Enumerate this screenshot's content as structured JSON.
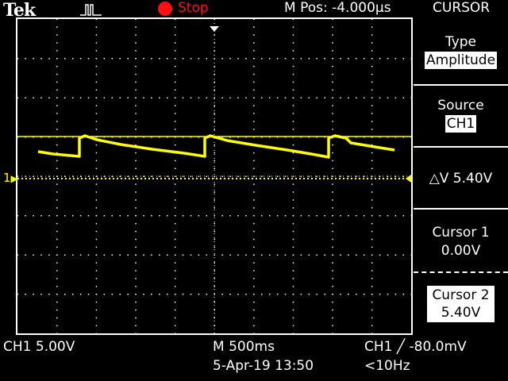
{
  "header": {
    "brand": "Tek",
    "run_state": "Stop",
    "m_pos": "M Pos: -4.000µs",
    "menu_title": "CURSOR"
  },
  "sidebar": {
    "type_label": "Type",
    "type_value": "Amplitude",
    "source_label": "Source",
    "source_value": "CH1",
    "delta_v": "△V 5.40V",
    "cursor1_label": "Cursor 1",
    "cursor1_value": "0.00V",
    "cursor2_label": "Cursor 2",
    "cursor2_value": "5.40V"
  },
  "footer": {
    "ch1_scale": "CH1  5.00V",
    "timebase": "M 500ms",
    "date_time": "5-Apr-19 13:50",
    "trigger": "CH1 ╱ -80.0mV",
    "freq": "<10Hz"
  },
  "channel_marker": "1",
  "colors": {
    "trace": "#ffff00",
    "stop": "#ff1010",
    "grid": "#ffffff"
  },
  "icons": {
    "trigger_type": "pulse-trigger-icon",
    "run_status": "stop-dot-icon"
  }
}
